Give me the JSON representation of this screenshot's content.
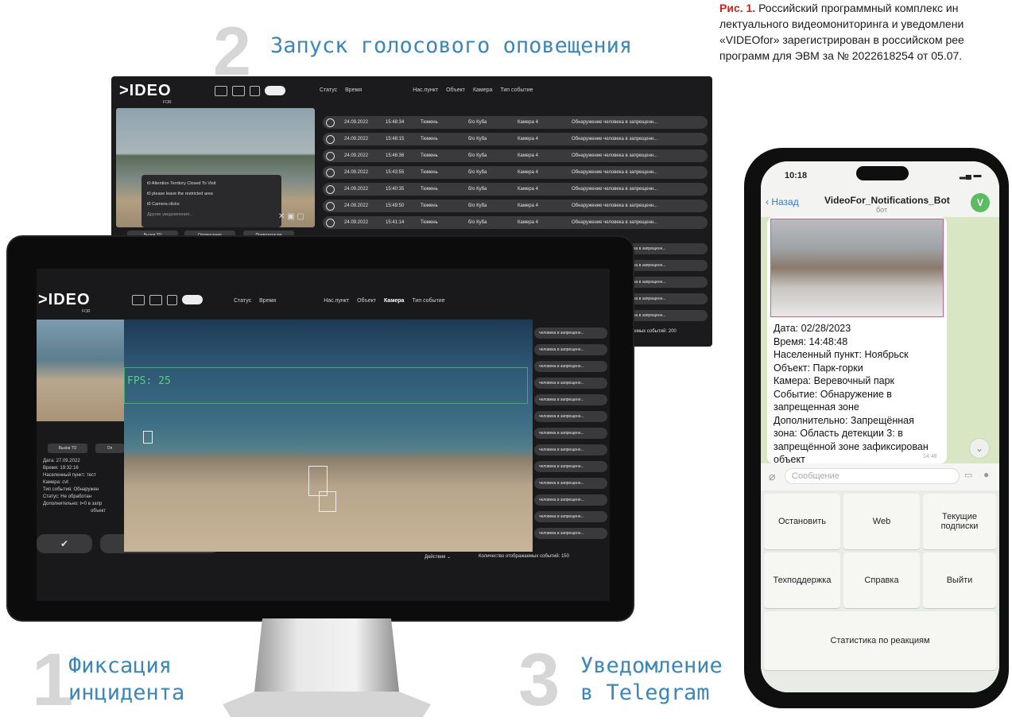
{
  "caption": {
    "fig": "Рис. 1.",
    "line1": " Российский программный комплекс ин",
    "line2": "лектуального видеомониторинга и уведомлени",
    "line3": "«VIDEOfor» зарегистрирован в российском рее",
    "line4": "программ для ЭВМ за № 2022618254 от 05.07."
  },
  "steps": {
    "s1": {
      "num": "1",
      "line1": "Фиксация",
      "line2": "инцидента"
    },
    "s2": {
      "num": "2",
      "line1": "Запуск голосового оповещения"
    },
    "s3": {
      "num": "3",
      "line1": "Уведомление",
      "line2": "в Telegram"
    }
  },
  "colors": {
    "accent": "#3d87b6",
    "fig_red": "#c0281f",
    "panel": "#1b1b1d",
    "chat_bg": "#d8e6c4",
    "tg_green": "#5dbb63"
  },
  "app": {
    "logo": ">IDEO",
    "logo_sub": "FOR",
    "filters": {
      "status": "Статус",
      "time": "Время",
      "settlement": "Нас.пункт",
      "object": "Объект",
      "camera": "Камера",
      "event_type": "Тип событие"
    }
  },
  "back_panel": {
    "rows": [
      {
        "date": "24.09.2022",
        "time": "15:48:34",
        "city": "Тюмень",
        "obj": "б/о Куба",
        "cam": "Камера 4",
        "event": "Обнаружение человека в запрещенн..."
      },
      {
        "date": "24.09.2022",
        "time": "15:48:15",
        "city": "Тюмень",
        "obj": "б/о Куба",
        "cam": "Камера 4",
        "event": "Обнаружение человека в запрещенн..."
      },
      {
        "date": "24.09.2022",
        "time": "15:46:36",
        "city": "Тюмень",
        "obj": "б/о Куба",
        "cam": "Камера 4",
        "event": "Обнаружение человека в запрещенн..."
      },
      {
        "date": "24.09.2022",
        "time": "15:43:55",
        "city": "Тюмень",
        "obj": "б/о Куба",
        "cam": "Камера 4",
        "event": "Обнаружение человека в запрещенн..."
      },
      {
        "date": "24.09.2022",
        "time": "15:40:35",
        "city": "Тюмень",
        "obj": "б/о Куба",
        "cam": "Камера 4",
        "event": "Обнаружение человека в запрещенн..."
      },
      {
        "date": "24.09.2022",
        "time": "15:49:50",
        "city": "Тюмень",
        "obj": "б/о Куба",
        "cam": "Камера 4",
        "event": "Обнаружение человека в запрещенн..."
      },
      {
        "date": "24.09.2022",
        "time": "15:41:14",
        "city": "Тюмень",
        "obj": "б/о Куба",
        "cam": "Камера 4",
        "event": "Обнаружение человека в запрещенн..."
      }
    ],
    "extra_rows": [
      "ловека в запрещенн...",
      "ловека в запрещенн...",
      "ловека в запрещенн...",
      "ловека в запрещенн...",
      "ловека в запрещенн..."
    ],
    "count_text": "жаемых событий: 200",
    "menu": {
      "item1": "t0 Attention Territory Closed To Visit",
      "item2": "t0 please leave the restricted area",
      "item3": "t0 Camera clicks",
      "item4": "Другие уведомления..."
    },
    "buttons": {
      "b1": "Вызов ТО",
      "b2": "Оповещение",
      "b3": "Приватизация"
    }
  },
  "monitor": {
    "fps": "FPS: 25",
    "rows": [
      "человека в запрещенн...",
      "человека в запрещенн...",
      "человека в запрещенн...",
      "человека в запрещенн...",
      "человека в запрещенн...",
      "человека в запрещенн...",
      "человека в запрещенн...",
      "человека в запрещенн...",
      "человека в запрещенн...",
      "человека в запрещенн...",
      "человека в запрещенн...",
      "человека в запрещенн...",
      "человека в запрещенн..."
    ],
    "actions": "Действия",
    "count": "Количество отображаемых событий: 150",
    "buttons": {
      "b1": "Вызов ТО",
      "b2": "Оп"
    },
    "details": {
      "date": "Дата: 27.09.2022",
      "time": "Время: 19:32:16",
      "settlement": "Населенный пункт: тест",
      "camera": "Камера: cvt",
      "event": "Тип события: Обнаружен",
      "status": "Статус: Не обработан",
      "extra": "Дополнительно: t=0 в запр",
      "extra2": "объект"
    }
  },
  "phone": {
    "time": "10:18",
    "back": "Назад",
    "bot_name": "VideoFor_Notifications_Bot",
    "bot_sub": "бот",
    "avatar": "V",
    "message": {
      "l1": "Дата: 02/28/2023",
      "l2": "Время:  14:48:48",
      "l3": "Населенный пункт: Ноябрьск",
      "l4": "Объект: Парк-горки",
      "l5": "Камера: Веревочный парк",
      "l6": "Событие: Обнаружение в",
      "l7": "запрещенная зоне",
      "l8": "Дополнительно: Запрещённая",
      "l9": "зона: Область детекции 3: в",
      "l10": "запрещённой зоне зафиксирован",
      "l11": "объект",
      "ts": "14:48"
    },
    "input_placeholder": "Сообщение",
    "keyboard": {
      "stop": "Остановить",
      "web": "Web",
      "subs": "Текущие подписки",
      "support": "Техподдержка",
      "help": "Справка",
      "exit": "Выйти",
      "stats": "Статистика по реакциям"
    }
  }
}
